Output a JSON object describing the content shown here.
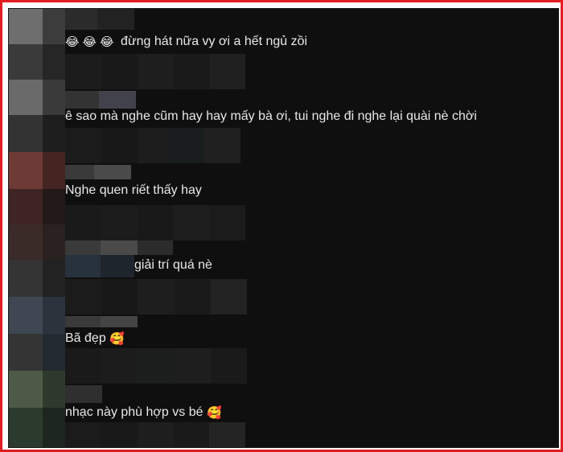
{
  "comments": [
    {
      "text": "đừng hát nữa vy ơi a hết ngủ zồi",
      "emojis": [
        "😂",
        "😂",
        "😂"
      ],
      "emoji_position": "before"
    },
    {
      "text": "ê sao mà nghe cũm hay hay mấy bà ơi, tui nghe đi nghe lại quài nè chời"
    },
    {
      "text": "Nghe quen riết thấy hay"
    },
    {
      "text": "giải trí quá nè"
    },
    {
      "text": "Bã đẹp",
      "emojis": [
        "🥰"
      ],
      "emoji_position": "after"
    },
    {
      "text": "nhạc này phù hợp vs bé",
      "emojis": [
        "🥰"
      ],
      "emoji_position": "after"
    }
  ],
  "colors": {
    "frame_border": "#e11d21",
    "background": "#0f0f0f",
    "text": "#e8e8e8"
  }
}
